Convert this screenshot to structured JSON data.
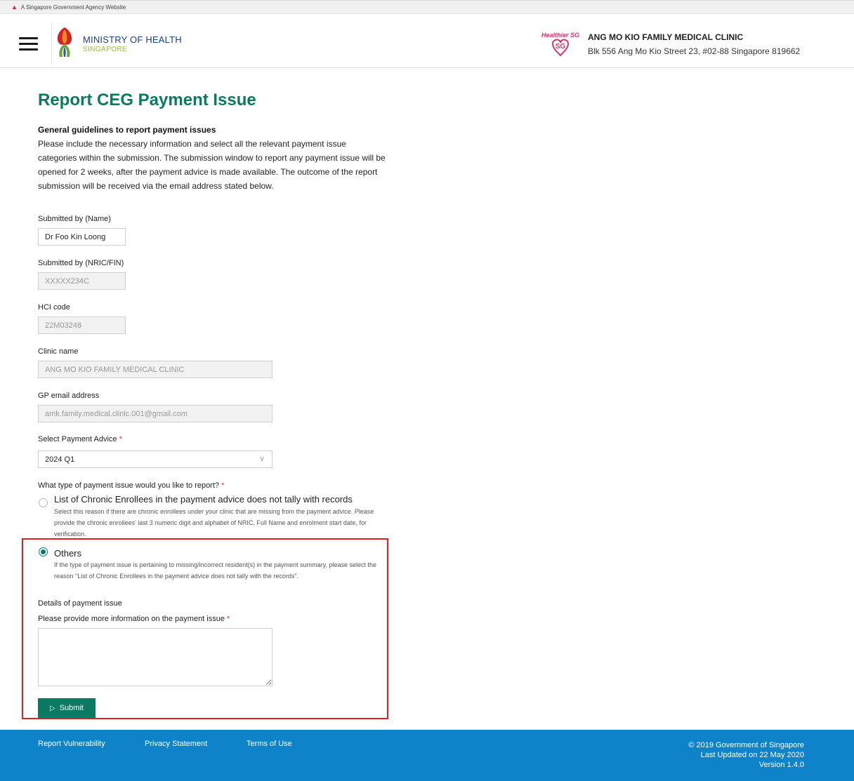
{
  "gov_banner": {
    "text": "A Singapore Government Agency Website"
  },
  "header": {
    "ministry_name": "MINISTRY OF HEALTH",
    "ministry_sub": "SINGAPORE",
    "badge_text": "Healthier SG",
    "clinic_name": "ANG MO KIO FAMILY MEDICAL CLINIC",
    "clinic_address": "Blk 556 Ang Mo Kio Street 23, #02-88 Singapore 819662"
  },
  "page": {
    "title": "Report CEG Payment Issue"
  },
  "guidelines": {
    "heading": "General guidelines to report payment issues",
    "body": "Please include the necessary information and select all the relevant payment issue categories within the submission. The submission window to report any payment issue will be opened for 2 weeks, after the payment advice is made available. The outcome of the report submission will be received via the email address stated below."
  },
  "form": {
    "submitted_name": {
      "label": "Submitted by (Name)",
      "value": "Dr Foo Kin Loong"
    },
    "submitted_nric": {
      "label": "Submitted by (NRIC/FIN)",
      "value": "XXXXX234C"
    },
    "hci_code": {
      "label": "HCI code",
      "value": "22M03246"
    },
    "clinic_name": {
      "label": "Clinic name",
      "value": "ANG MO KIO FAMILY MEDICAL CLINIC"
    },
    "gp_email": {
      "label": "GP email address",
      "value": "amk.family.medical.clinic.001@gmail.com"
    },
    "payment_advice": {
      "label": "Select Payment Advice",
      "required_mark": "*",
      "value": "2024 Q1"
    },
    "issue_type": {
      "question": "What type of payment issue would you like to report?",
      "required_mark": "*",
      "options": [
        {
          "title": "List of Chronic Enrollees in the payment advice does not tally with records",
          "desc": "Select this reason if there are chronic enrollees under your clinic that are missing from the payment advice. Please provide the chronic enrollees' last 3 numeric digit and alphabet of NRIC, Full Name and enrolment start date, for verification.",
          "selected": false
        },
        {
          "title": "Others",
          "desc": "If the type of payment issue is pertaining to missing/incorrect resident(s) in the payment summary, please select the reason \"List of Chronic Enrollees in the payment advice does not tally with the records\".",
          "selected": true
        }
      ]
    },
    "details": {
      "heading": "Details of payment issue",
      "label": "Please provide more information on the payment issue",
      "required_mark": "*",
      "value": ""
    },
    "submit_label": "Submit"
  },
  "footer": {
    "links": [
      "Report Vulnerability",
      "Privacy Statement",
      "Terms of Use"
    ],
    "copyright": "© 2019 Government of Singapore",
    "last_updated": "Last Updated on 22 May 2020",
    "version": "Version 1.4.0"
  },
  "colors": {
    "accent_green": "#0b7a63",
    "footer_blue": "#0e83c9",
    "highlight_red": "#e02020",
    "required_red": "#d83131"
  }
}
